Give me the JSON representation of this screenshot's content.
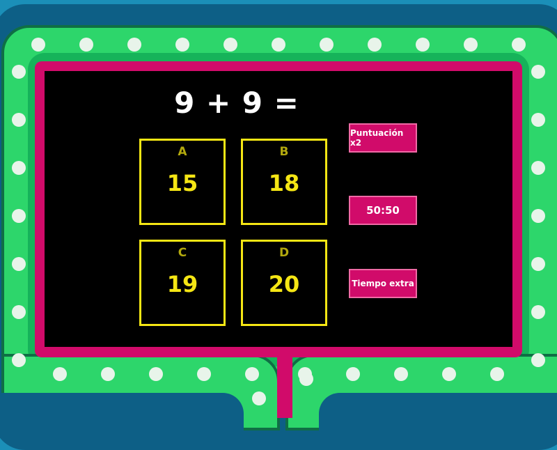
{
  "question": {
    "text": "9 + 9 ="
  },
  "answers": [
    {
      "letter": "A",
      "value": "15"
    },
    {
      "letter": "B",
      "value": "18"
    },
    {
      "letter": "C",
      "value": "19"
    },
    {
      "letter": "D",
      "value": "20"
    }
  ],
  "powerups": [
    {
      "label": "Puntuación x2"
    },
    {
      "label": "50:50"
    },
    {
      "label": "Tiempo extra"
    }
  ],
  "colors": {
    "background": "#1b8fb8",
    "frame_green": "#2dd66b",
    "screen_border": "#d10b6a",
    "answer_yellow": "#f5e614",
    "screen": "#000000"
  }
}
